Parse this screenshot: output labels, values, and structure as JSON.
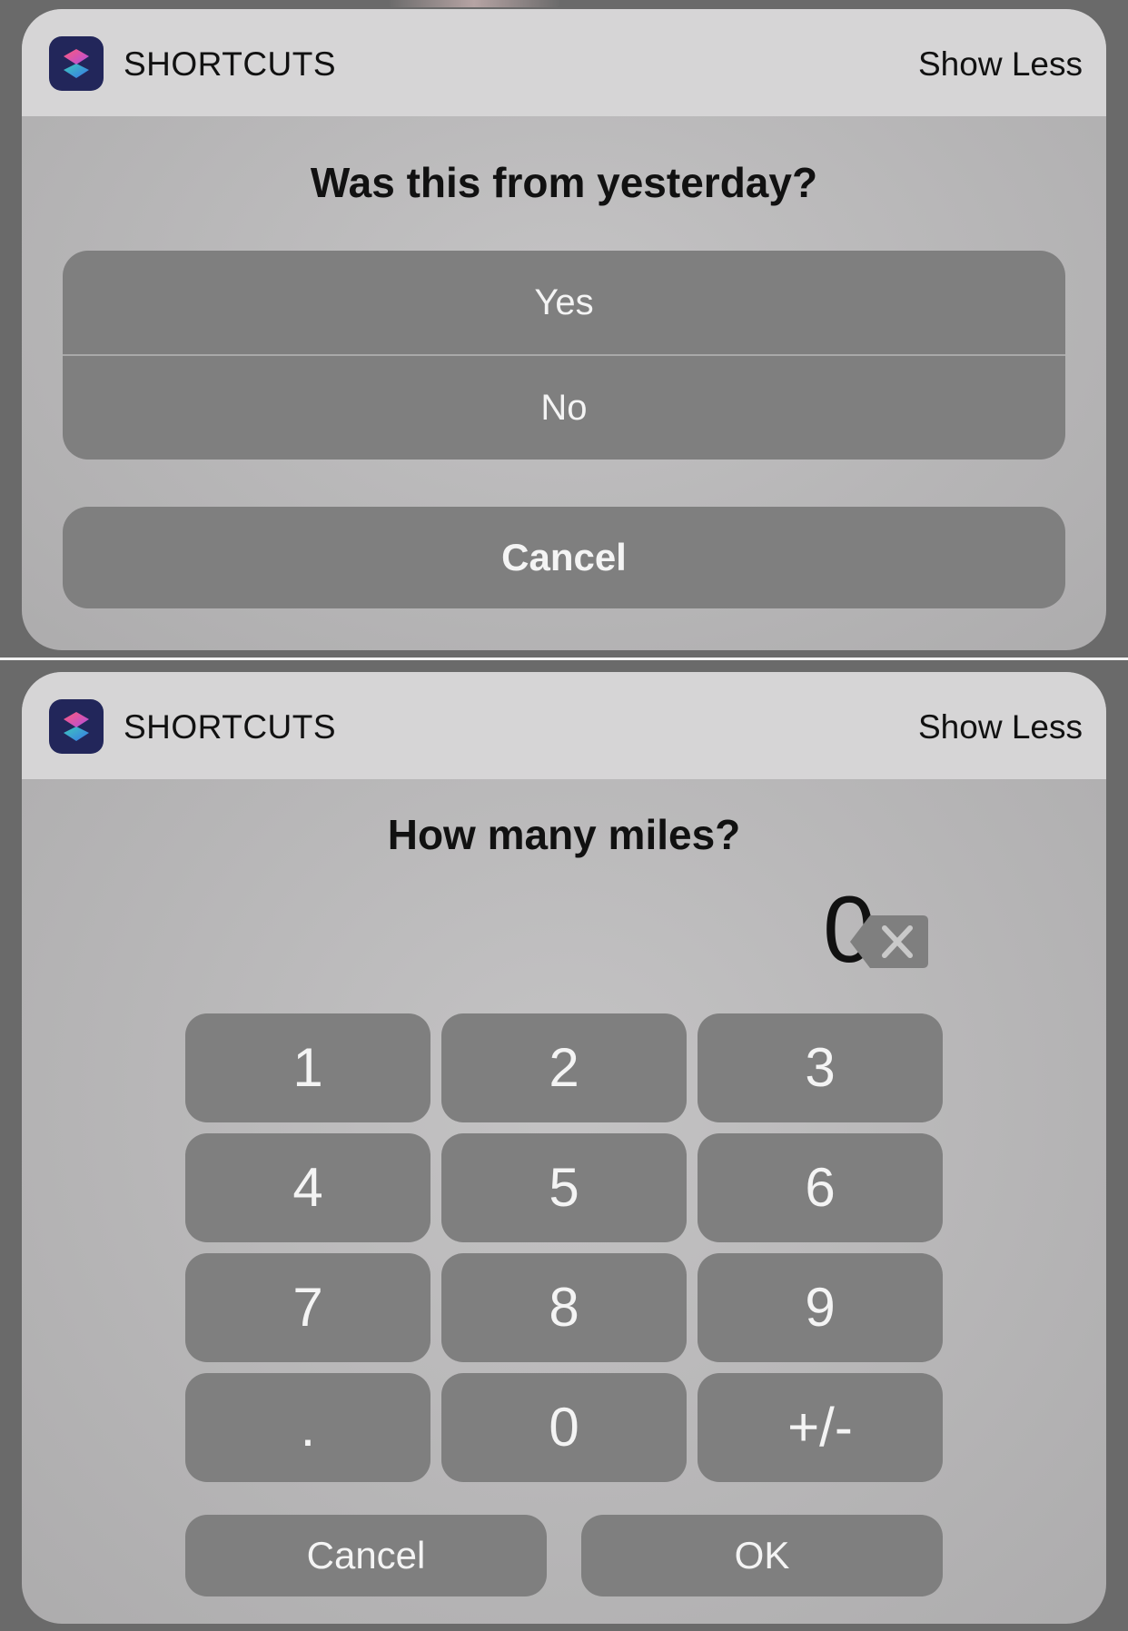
{
  "notification_one": {
    "app_name": "SHORTCUTS",
    "show_less": "Show Less",
    "question": "Was this from yesterday?",
    "choices": [
      "Yes",
      "No"
    ],
    "cancel_label": "Cancel"
  },
  "notification_two": {
    "app_name": "SHORTCUTS",
    "show_less": "Show Less",
    "question": "How many miles?",
    "display_value": "0",
    "keys": [
      "1",
      "2",
      "3",
      "4",
      "5",
      "6",
      "7",
      "8",
      "9",
      ".",
      "0",
      "+/-"
    ],
    "cancel_label": "Cancel",
    "ok_label": "OK"
  },
  "icons": {
    "app": "shortcuts-app-icon",
    "backspace": "backspace-icon"
  },
  "colors": {
    "button_fill": "#7f7f7f",
    "card_header": "#d6d5d6",
    "app_icon_bg": "#22265a"
  }
}
